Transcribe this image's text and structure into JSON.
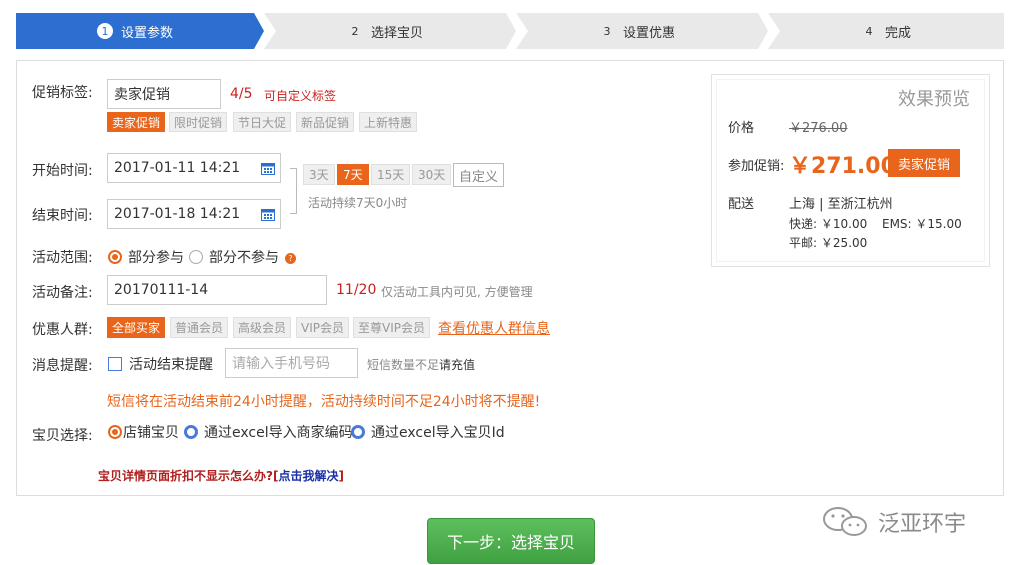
{
  "steps": [
    {
      "num": "1",
      "label": "设置参数"
    },
    {
      "num": "2",
      "label": "选择宝贝"
    },
    {
      "num": "3",
      "label": "设置优惠"
    },
    {
      "num": "4",
      "label": "完成"
    }
  ],
  "promo_tag": {
    "label": "促销标签:",
    "value": "卖家促销",
    "count": "4/5",
    "custom_link": "可自定义标签",
    "presets": [
      "卖家促销",
      "限时促销",
      "节日大促",
      "新品促销",
      "上新特惠"
    ]
  },
  "start_time": {
    "label": "开始时间:",
    "value": "2017-01-11 14:21"
  },
  "end_time": {
    "label": "结束时间:",
    "value": "2017-01-18 14:21"
  },
  "durations": [
    "3天",
    "7天",
    "15天",
    "30天",
    "自定义"
  ],
  "duration_note": "活动持续7天0小时",
  "scope": {
    "label": "活动范围:",
    "options": [
      "部分参与",
      "部分不参与"
    ],
    "help_icon": "?"
  },
  "remark": {
    "label": "活动备注:",
    "value": "20170111-14",
    "count": "11/20",
    "note": "仅活动工具内可见, 方便管理"
  },
  "audience": {
    "label": "优惠人群:",
    "options": [
      "全部买家",
      "普通会员",
      "高级会员",
      "VIP会员",
      "至尊VIP会员"
    ],
    "link": "查看优惠人群信息"
  },
  "sms": {
    "label": "消息提醒:",
    "checkbox_label": "活动结束提醒",
    "placeholder": "请输入手机号码",
    "note_prefix": "短信数量不足",
    "note_link": "请充值"
  },
  "sms_warning": "短信将在活动结束前24小时提醒，活动持续时间不足24小时将不提醒!",
  "item_select": {
    "label": "宝贝选择:",
    "options": [
      "店铺宝贝",
      "通过excel导入商家编码",
      "通过excel导入宝贝Id"
    ]
  },
  "help": {
    "question": "宝贝详情页面折扣不显示怎么办?",
    "bracket_open": "[",
    "link": "点击我解决",
    "bracket_close": "]"
  },
  "preview": {
    "title": "效果预览",
    "price_label": "价格",
    "price": "￥276.00",
    "promo_label": "参加促销:",
    "promo_price": "￥271.00",
    "promo_badge": "卖家促销",
    "ship_label": "配送",
    "ship_route": "上海 | 至浙江杭州",
    "express": "快递: ￥10.00",
    "ems": "EMS: ￥15.00",
    "post": "平邮: ￥25.00"
  },
  "next_button": "下一步：选择宝贝",
  "watermark": "泛亚环宇",
  "colors": {
    "accent": "#e8651b",
    "primary": "#2d6fd1",
    "warning": "#c9211e",
    "button": "#4cae4c"
  }
}
